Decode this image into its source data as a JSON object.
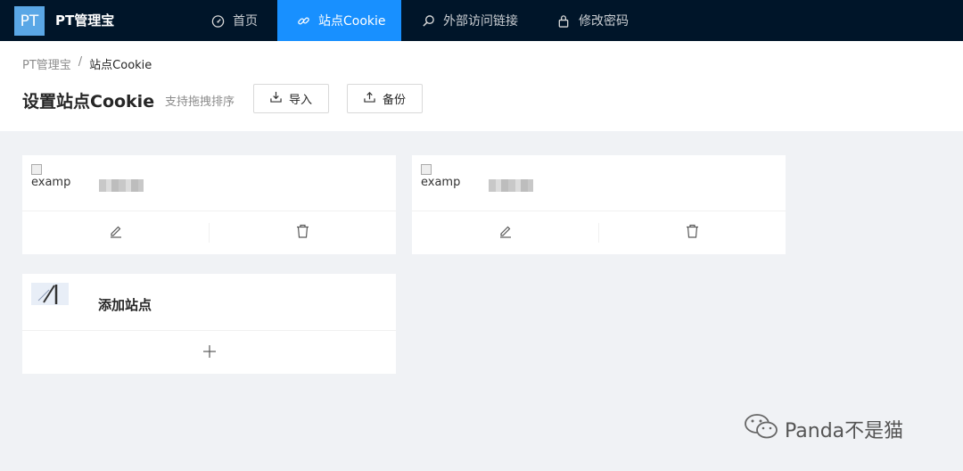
{
  "app": {
    "logo": "PT",
    "title": "PT管理宝"
  },
  "nav": [
    {
      "label": "首页",
      "icon": "dashboard-icon"
    },
    {
      "label": "站点Cookie",
      "icon": "link-icon"
    },
    {
      "label": "外部访问链接",
      "icon": "search-icon"
    },
    {
      "label": "修改密码",
      "icon": "lock-icon"
    }
  ],
  "breadcrumb": {
    "root": "PT管理宝",
    "separator": "/",
    "current": "站点Cookie"
  },
  "page": {
    "title": "设置站点Cookie",
    "subtitle": "支持拖拽排序",
    "import_label": "导入",
    "backup_label": "备份"
  },
  "cards": [
    {
      "img_alt": "examp"
    },
    {
      "img_alt": "examp"
    }
  ],
  "add_card": {
    "title": "添加站点",
    "add_symbol": "+"
  },
  "watermark": {
    "text": "Panda不是猫"
  },
  "colors": {
    "nav_bg": "#001529",
    "accent": "#1890ff",
    "page_bg": "#f0f2f5"
  }
}
